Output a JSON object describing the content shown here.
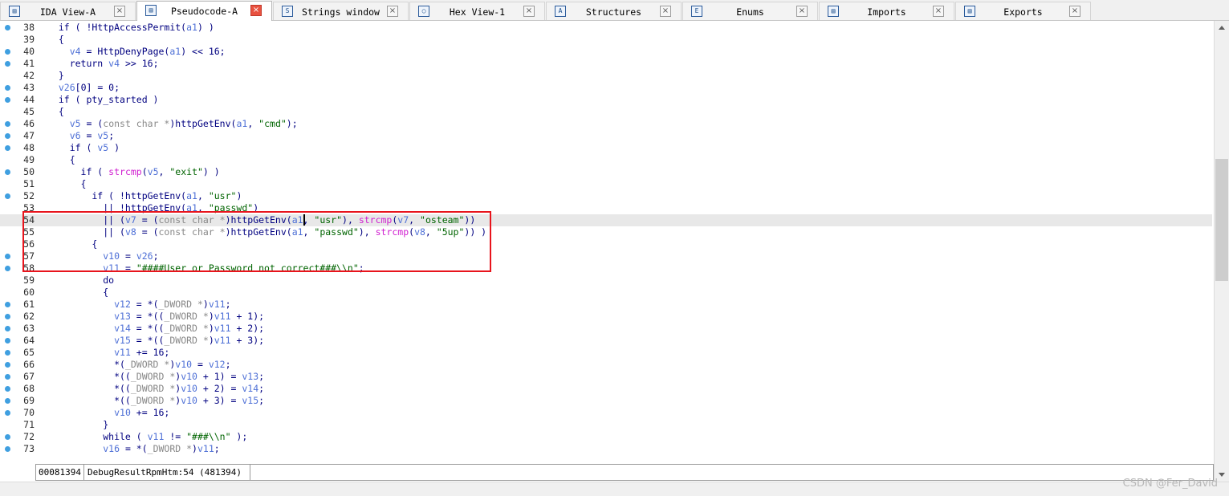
{
  "tabs": [
    {
      "label": "IDA View-A",
      "icon": "ida-view-icon",
      "active": false
    },
    {
      "label": "Pseudocode-A",
      "icon": "pseudocode-icon",
      "active": true
    },
    {
      "label": "Strings window",
      "icon": "strings-icon",
      "active": false
    },
    {
      "label": "Hex View-1",
      "icon": "hex-view-icon",
      "active": false
    },
    {
      "label": "Structures",
      "icon": "structures-icon",
      "active": false
    },
    {
      "label": "Enums",
      "icon": "enums-icon",
      "active": false
    },
    {
      "label": "Imports",
      "icon": "imports-icon",
      "active": false
    },
    {
      "label": "Exports",
      "icon": "exports-icon",
      "active": false
    }
  ],
  "code": [
    {
      "no": "38",
      "dot": true,
      "tokens": [
        [
          "p",
          "  if ( !"
        ],
        [
          "k",
          "HttpAccessPermit"
        ],
        [
          "p",
          "("
        ],
        [
          "vr",
          "a1"
        ],
        [
          "p",
          ") )"
        ]
      ]
    },
    {
      "no": "39",
      "dot": false,
      "tokens": [
        [
          "p",
          "  {"
        ]
      ]
    },
    {
      "no": "40",
      "dot": true,
      "tokens": [
        [
          "p",
          "    "
        ],
        [
          "vr",
          "v4"
        ],
        [
          "p",
          " = HttpDenyPage("
        ],
        [
          "vr",
          "a1"
        ],
        [
          "p",
          ") << 16;"
        ]
      ]
    },
    {
      "no": "41",
      "dot": true,
      "tokens": [
        [
          "p",
          "    return "
        ],
        [
          "vr",
          "v4"
        ],
        [
          "p",
          " >> 16;"
        ]
      ]
    },
    {
      "no": "42",
      "dot": false,
      "tokens": [
        [
          "p",
          "  }"
        ]
      ]
    },
    {
      "no": "43",
      "dot": true,
      "tokens": [
        [
          "p",
          "  "
        ],
        [
          "vr",
          "v26"
        ],
        [
          "p",
          "[0] = 0;"
        ]
      ]
    },
    {
      "no": "44",
      "dot": true,
      "tokens": [
        [
          "p",
          "  if ( pty_started )"
        ]
      ]
    },
    {
      "no": "45",
      "dot": false,
      "tokens": [
        [
          "p",
          "  {"
        ]
      ]
    },
    {
      "no": "46",
      "dot": true,
      "tokens": [
        [
          "p",
          "    "
        ],
        [
          "vr",
          "v5"
        ],
        [
          "p",
          " = ("
        ],
        [
          "t",
          "const char *"
        ],
        [
          "p",
          ")httpGetEnv("
        ],
        [
          "vr",
          "a1"
        ],
        [
          "p",
          ", "
        ],
        [
          "s",
          "\"cmd\""
        ],
        [
          "p",
          ");"
        ]
      ]
    },
    {
      "no": "47",
      "dot": true,
      "tokens": [
        [
          "p",
          "    "
        ],
        [
          "vr",
          "v6"
        ],
        [
          "p",
          " = "
        ],
        [
          "vr",
          "v5"
        ],
        [
          "p",
          ";"
        ]
      ]
    },
    {
      "no": "48",
      "dot": true,
      "tokens": [
        [
          "p",
          "    if ( "
        ],
        [
          "vr",
          "v5"
        ],
        [
          "p",
          " )"
        ]
      ]
    },
    {
      "no": "49",
      "dot": false,
      "tokens": [
        [
          "p",
          "    {"
        ]
      ]
    },
    {
      "no": "50",
      "dot": true,
      "tokens": [
        [
          "p",
          "      if ( "
        ],
        [
          "f",
          "strcmp"
        ],
        [
          "p",
          "("
        ],
        [
          "vr",
          "v5"
        ],
        [
          "p",
          ", "
        ],
        [
          "s",
          "\"exit\""
        ],
        [
          "p",
          ") )"
        ]
      ]
    },
    {
      "no": "51",
      "dot": false,
      "tokens": [
        [
          "p",
          "      {"
        ]
      ]
    },
    {
      "no": "52",
      "dot": true,
      "tokens": [
        [
          "p",
          "        if ( !httpGetEnv("
        ],
        [
          "vr",
          "a1"
        ],
        [
          "p",
          ", "
        ],
        [
          "s",
          "\"usr\""
        ],
        [
          "p",
          ")"
        ]
      ]
    },
    {
      "no": "53",
      "dot": false,
      "tokens": [
        [
          "p",
          "          || !httpGetEnv("
        ],
        [
          "vr",
          "a1"
        ],
        [
          "p",
          ", "
        ],
        [
          "s",
          "\"passwd\""
        ],
        [
          "p",
          ")"
        ]
      ]
    },
    {
      "no": "54",
      "dot": false,
      "tokens": [
        [
          "p",
          "          || ("
        ],
        [
          "vr",
          "v7"
        ],
        [
          "p",
          " = ("
        ],
        [
          "t",
          "const char *"
        ],
        [
          "p",
          ")httpGetEnv("
        ],
        [
          "vr",
          "a1"
        ],
        [
          "p",
          ", "
        ],
        [
          "s",
          "\"usr\""
        ],
        [
          "p",
          "), "
        ],
        [
          "f",
          "strcmp"
        ],
        [
          "p",
          "("
        ],
        [
          "vr",
          "v7"
        ],
        [
          "p",
          ", "
        ],
        [
          "s",
          "\"osteam\""
        ],
        [
          "p",
          "))"
        ]
      ]
    },
    {
      "no": "55",
      "dot": false,
      "tokens": [
        [
          "p",
          "          || ("
        ],
        [
          "vr",
          "v8"
        ],
        [
          "p",
          " = ("
        ],
        [
          "t",
          "const char *"
        ],
        [
          "p",
          ")httpGetEnv("
        ],
        [
          "vr",
          "a1"
        ],
        [
          "p",
          ", "
        ],
        [
          "s",
          "\"passwd\""
        ],
        [
          "p",
          "), "
        ],
        [
          "f",
          "strcmp"
        ],
        [
          "p",
          "("
        ],
        [
          "vr",
          "v8"
        ],
        [
          "p",
          ", "
        ],
        [
          "s",
          "\"5up\""
        ],
        [
          "p",
          ")) )"
        ]
      ]
    },
    {
      "no": "56",
      "dot": false,
      "tokens": [
        [
          "p",
          "        {"
        ]
      ]
    },
    {
      "no": "57",
      "dot": true,
      "tokens": [
        [
          "p",
          "          "
        ],
        [
          "vr",
          "v10"
        ],
        [
          "p",
          " = "
        ],
        [
          "vr",
          "v26"
        ],
        [
          "p",
          ";"
        ]
      ]
    },
    {
      "no": "58",
      "dot": true,
      "tokens": [
        [
          "p",
          "          "
        ],
        [
          "vr",
          "v11"
        ],
        [
          "p",
          " = "
        ],
        [
          "s",
          "\"####User or Password not correct###\\\\n\""
        ],
        [
          "p",
          ";"
        ]
      ]
    },
    {
      "no": "59",
      "dot": false,
      "tokens": [
        [
          "p",
          "          do"
        ]
      ]
    },
    {
      "no": "60",
      "dot": false,
      "tokens": [
        [
          "p",
          "          {"
        ]
      ]
    },
    {
      "no": "61",
      "dot": true,
      "tokens": [
        [
          "p",
          "            "
        ],
        [
          "vr",
          "v12"
        ],
        [
          "p",
          " = *("
        ],
        [
          "t",
          "_DWORD *"
        ],
        [
          "p",
          ")"
        ],
        [
          "vr",
          "v11"
        ],
        [
          "p",
          ";"
        ]
      ]
    },
    {
      "no": "62",
      "dot": true,
      "tokens": [
        [
          "p",
          "            "
        ],
        [
          "vr",
          "v13"
        ],
        [
          "p",
          " = *(("
        ],
        [
          "t",
          "_DWORD *"
        ],
        [
          "p",
          ")"
        ],
        [
          "vr",
          "v11"
        ],
        [
          "p",
          " + 1);"
        ]
      ]
    },
    {
      "no": "63",
      "dot": true,
      "tokens": [
        [
          "p",
          "            "
        ],
        [
          "vr",
          "v14"
        ],
        [
          "p",
          " = *(("
        ],
        [
          "t",
          "_DWORD *"
        ],
        [
          "p",
          ")"
        ],
        [
          "vr",
          "v11"
        ],
        [
          "p",
          " + 2);"
        ]
      ]
    },
    {
      "no": "64",
      "dot": true,
      "tokens": [
        [
          "p",
          "            "
        ],
        [
          "vr",
          "v15"
        ],
        [
          "p",
          " = *(("
        ],
        [
          "t",
          "_DWORD *"
        ],
        [
          "p",
          ")"
        ],
        [
          "vr",
          "v11"
        ],
        [
          "p",
          " + 3);"
        ]
      ]
    },
    {
      "no": "65",
      "dot": true,
      "tokens": [
        [
          "p",
          "            "
        ],
        [
          "vr",
          "v11"
        ],
        [
          "p",
          " += 16;"
        ]
      ]
    },
    {
      "no": "66",
      "dot": true,
      "tokens": [
        [
          "p",
          "            *("
        ],
        [
          "t",
          "_DWORD *"
        ],
        [
          "p",
          ")"
        ],
        [
          "vr",
          "v10"
        ],
        [
          "p",
          " = "
        ],
        [
          "vr",
          "v12"
        ],
        [
          "p",
          ";"
        ]
      ]
    },
    {
      "no": "67",
      "dot": true,
      "tokens": [
        [
          "p",
          "            *(("
        ],
        [
          "t",
          "_DWORD *"
        ],
        [
          "p",
          ")"
        ],
        [
          "vr",
          "v10"
        ],
        [
          "p",
          " + 1) = "
        ],
        [
          "vr",
          "v13"
        ],
        [
          "p",
          ";"
        ]
      ]
    },
    {
      "no": "68",
      "dot": true,
      "tokens": [
        [
          "p",
          "            *(("
        ],
        [
          "t",
          "_DWORD *"
        ],
        [
          "p",
          ")"
        ],
        [
          "vr",
          "v10"
        ],
        [
          "p",
          " + 2) = "
        ],
        [
          "vr",
          "v14"
        ],
        [
          "p",
          ";"
        ]
      ]
    },
    {
      "no": "69",
      "dot": true,
      "tokens": [
        [
          "p",
          "            *(("
        ],
        [
          "t",
          "_DWORD *"
        ],
        [
          "p",
          ")"
        ],
        [
          "vr",
          "v10"
        ],
        [
          "p",
          " + 3) = "
        ],
        [
          "vr",
          "v15"
        ],
        [
          "p",
          ";"
        ]
      ]
    },
    {
      "no": "70",
      "dot": true,
      "tokens": [
        [
          "p",
          "            "
        ],
        [
          "vr",
          "v10"
        ],
        [
          "p",
          " += 16;"
        ]
      ]
    },
    {
      "no": "71",
      "dot": false,
      "tokens": [
        [
          "p",
          "          }"
        ]
      ]
    },
    {
      "no": "72",
      "dot": true,
      "tokens": [
        [
          "p",
          "          while ( "
        ],
        [
          "vr",
          "v11"
        ],
        [
          "p",
          " != "
        ],
        [
          "s",
          "\"###\\\\n\""
        ],
        [
          "p",
          " );"
        ]
      ]
    },
    {
      "no": "73",
      "dot": true,
      "tokens": [
        [
          "p",
          "          "
        ],
        [
          "vr",
          "v16"
        ],
        [
          "p",
          " = *("
        ],
        [
          "t",
          "_DWORD *"
        ],
        [
          "p",
          ")"
        ],
        [
          "vr",
          "v11"
        ],
        [
          "p",
          ";"
        ]
      ]
    }
  ],
  "highlighted_line": "54",
  "status": {
    "address": "00081394",
    "location": "DebugResultRpmHtm:54 (481394)"
  },
  "watermark": "CSDN @Fer_David",
  "colors": {
    "keyword": "#000080",
    "variable": "#4d6fd6",
    "string": "#006400",
    "function_call": "#d020d0",
    "type": "#888888",
    "breakpoint_dot": "#3f9fe0",
    "annotation_box": "#e8141c"
  }
}
